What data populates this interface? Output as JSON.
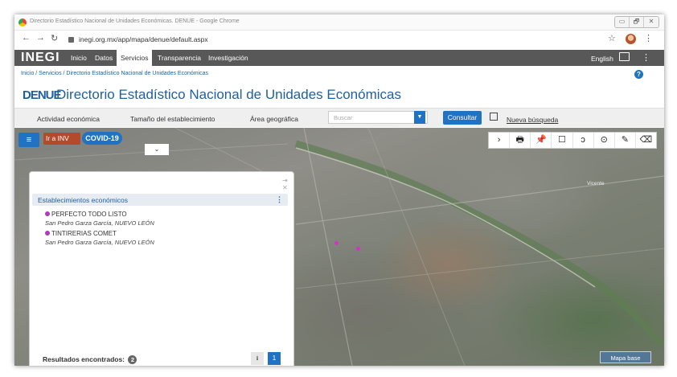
{
  "browser": {
    "window_title": "Directorio Estadístico Nacional de Unidades Económicas. DENUE - Google Chrome",
    "url": "inegi.org.mx/app/mapa/denue/default.aspx",
    "window_controls": [
      "▭",
      "🗗",
      "✕"
    ]
  },
  "site_nav": {
    "logo": "INEGI",
    "items": [
      "Inicio",
      "Datos",
      "Servicios",
      "Transparencia",
      "Investigación"
    ],
    "active": "Servicios",
    "language": "English"
  },
  "breadcrumb": "Inicio / Servicios / Directorio Estadístico Nacional de Unidades Económicas",
  "page": {
    "brand": "DENUE",
    "title": "Directorio Estadístico Nacional de Unidades Económicas"
  },
  "filters": {
    "actividad": "Actividad económica",
    "tamano": "Tamaño del establecimiento",
    "area": "Área geográfica",
    "search_placeholder": "Buscar",
    "consultar": "Consultar",
    "nueva": "Nueva búsqueda"
  },
  "map": {
    "ir_a_inv": "Ir a INV",
    "covid": "COVID-19",
    "place_label": "Vicente",
    "badge": "Mapa base",
    "tools": [
      "›",
      "🖶",
      "📌",
      "☐",
      "ↄ",
      "⊙",
      "✎",
      "⌫"
    ]
  },
  "results": {
    "header": "Establecimientos económicos",
    "items": [
      {
        "name": "PERFECTO TODO LISTO",
        "location": "San Pedro Garza García, NUEVO LEÓN"
      },
      {
        "name": "TINTIRERIAS COMET",
        "location": "San Pedro Garza García, NUEVO LEÓN"
      }
    ],
    "found_label": "Resultados encontrados:",
    "found_count": "2",
    "page": "1"
  },
  "colors": {
    "brand_blue": "#1f72c4",
    "nav_gray": "#585858",
    "marker": "#d631c9"
  }
}
